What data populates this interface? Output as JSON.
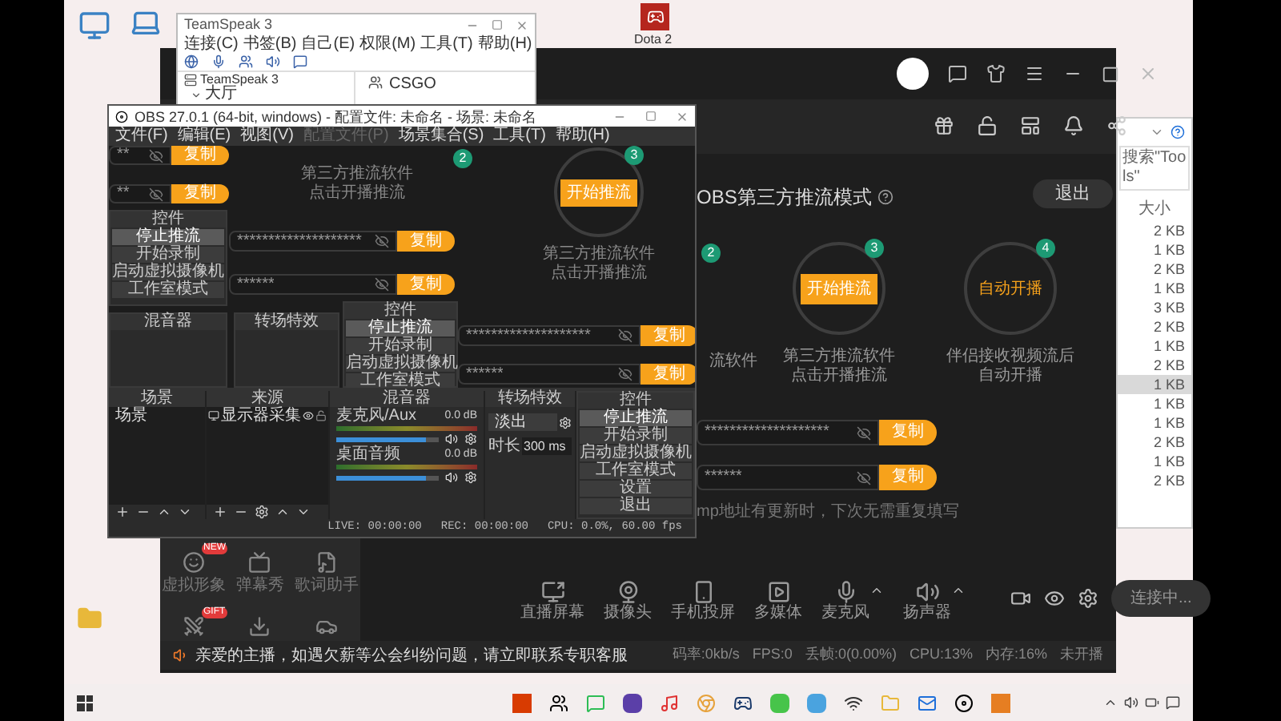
{
  "desktop": {
    "game_label": "Dota 2"
  },
  "teamspeak": {
    "title": "TeamSpeak 3",
    "menu": [
      "连接(C)",
      "书签(B)",
      "自己(E)",
      "权限(M)",
      "工具(T)",
      "帮助(H)"
    ],
    "tree": [
      {
        "label": "TeamSpeak 3",
        "expanded": true,
        "children": [
          {
            "label": "大厅"
          }
        ]
      }
    ],
    "info": "CSGO"
  },
  "stream_app": {
    "mode_title": "OBS第三方推流模式",
    "exit": "退出",
    "steps": [
      {
        "kind": "partial",
        "number": "2",
        "caption": [
          "流软件"
        ]
      },
      {
        "kind": "button",
        "number": "3",
        "label": "开始推流",
        "caption": [
          "第三方推流软件",
          "点击开播推流"
        ]
      },
      {
        "kind": "label",
        "number": "4",
        "label": "自动开播",
        "caption": [
          "伴侣接收视频流后",
          "自动开播"
        ]
      }
    ],
    "keys": [
      {
        "masked": "********************",
        "copy": "复制"
      },
      {
        "masked": "******",
        "copy": "复制"
      }
    ],
    "hint": "mp地址有更新时，下次无需重复填写",
    "sidebar": [
      {
        "kind": "avatar",
        "label": "虚拟形象",
        "badge": "NEW"
      },
      {
        "kind": "tv",
        "label": "弹幕秀"
      },
      {
        "kind": "lyrics",
        "label": "歌词助手"
      },
      {
        "kind": "pk",
        "badge": "GIFT"
      },
      {
        "kind": "download"
      },
      {
        "kind": "car"
      }
    ],
    "tools": [
      {
        "kind": "screen",
        "label": "直播屏幕",
        "dropdown": false
      },
      {
        "kind": "camera",
        "label": "摄像头",
        "dropdown": false
      },
      {
        "kind": "phone",
        "label": "手机投屏",
        "dropdown": false
      },
      {
        "kind": "media",
        "label": "多媒体",
        "dropdown": false
      },
      {
        "kind": "mic",
        "label": "麦克风",
        "dropdown": true
      },
      {
        "kind": "speaker",
        "label": "扬声器",
        "dropdown": true
      }
    ],
    "connect": "连接中...",
    "notice": "亲爱的主播，如遇欠薪等公会纠纷问题，请立即联系专职客服",
    "stats": [
      "码率:0kb/s",
      "FPS:0",
      "丢帧:0(0.00%)",
      "CPU:13%",
      "内存:16%"
    ],
    "live_state": "未开播"
  },
  "explorer": {
    "search": "搜索\"Tools\"",
    "column": "大小",
    "rows": [
      {
        "size": "2 KB",
        "selected": false
      },
      {
        "size": "1 KB",
        "selected": false
      },
      {
        "size": "2 KB",
        "selected": false
      },
      {
        "size": "1 KB",
        "selected": false
      },
      {
        "size": "3 KB",
        "selected": false
      },
      {
        "size": "2 KB",
        "selected": false
      },
      {
        "size": "1 KB",
        "selected": false
      },
      {
        "size": "2 KB",
        "selected": false
      },
      {
        "size": "1 KB",
        "selected": true
      },
      {
        "size": "1 KB",
        "selected": false
      },
      {
        "size": "1 KB",
        "selected": false
      },
      {
        "size": "2 KB",
        "selected": false
      },
      {
        "size": "1 KB",
        "selected": false
      },
      {
        "size": "2 KB",
        "selected": false
      }
    ]
  },
  "obs": {
    "title": "OBS 27.0.1 (64-bit, windows) - 配置文件: 未命名 - 场景: 未命名",
    "menu": [
      {
        "label": "文件(F)",
        "disabled": false
      },
      {
        "label": "编辑(E)",
        "disabled": false
      },
      {
        "label": "视图(V)",
        "disabled": false
      },
      {
        "label": "配置文件(P)",
        "disabled": true
      },
      {
        "label": "场景集合(S)",
        "disabled": false
      },
      {
        "label": "工具(T)",
        "disabled": false
      },
      {
        "label": "帮助(H)",
        "disabled": false
      }
    ],
    "preview": {
      "keys": [
        {
          "masked": "**",
          "copy": "复制"
        },
        {
          "masked": "**",
          "copy": "复制"
        },
        {
          "masked": "********************",
          "copy": "复制"
        },
        {
          "masked": "******",
          "copy": "复制"
        },
        {
          "masked": "********************",
          "copy": "复制"
        },
        {
          "masked": "******",
          "copy": "复制"
        }
      ],
      "badge": "2",
      "step": {
        "number": "3",
        "button": "开始推流"
      },
      "captions": [
        [
          "第三方推流软件",
          "点击开播推流"
        ],
        [
          "第三方推流软件",
          "点击开播推流"
        ]
      ],
      "controls": [
        {
          "title": "控件",
          "buttons": [
            {
              "label": "停止推流",
              "active": true
            },
            {
              "label": "开始录制",
              "active": false
            },
            {
              "label": "启动虚拟摄像机",
              "active": false
            },
            {
              "label": "工作室模式",
              "active": false
            }
          ]
        },
        {
          "title": "控件",
          "buttons": [
            {
              "label": "停止推流",
              "active": true
            },
            {
              "label": "开始录制",
              "active": false
            },
            {
              "label": "启动虚拟摄像机",
              "active": false
            },
            {
              "label": "工作室模式",
              "active": false
            }
          ]
        }
      ],
      "mixer_title": "混音器",
      "transition_title": "转场特效"
    },
    "scenes": {
      "title": "场景",
      "items": [
        "场景"
      ]
    },
    "sources": {
      "title": "来源",
      "items": [
        {
          "label": "显示器采集",
          "visible": true,
          "locked": false
        }
      ]
    },
    "mixer": {
      "title": "混音器",
      "channels": [
        {
          "name": "麦克风/Aux",
          "reading": "0.0 dB",
          "level": 0.88
        },
        {
          "name": "桌面音频",
          "reading": "0.0 dB",
          "level": 0.88
        }
      ]
    },
    "transitions": {
      "title": "转场特效",
      "effect": "淡出",
      "duration_label": "时长",
      "duration": "300 ms"
    },
    "controls": {
      "title": "控件",
      "buttons": [
        {
          "label": "停止推流",
          "active": true
        },
        {
          "label": "开始录制",
          "active": false
        },
        {
          "label": "启动虚拟摄像机",
          "active": false
        },
        {
          "label": "工作室模式",
          "active": false
        },
        {
          "label": "设置",
          "active": false
        },
        {
          "label": "退出",
          "active": false
        }
      ]
    },
    "status": {
      "live": "LIVE: 00:00:00",
      "rec": "REC: 00:00:00",
      "cpu": "CPU: 0.0%, 60.00 fps"
    }
  }
}
